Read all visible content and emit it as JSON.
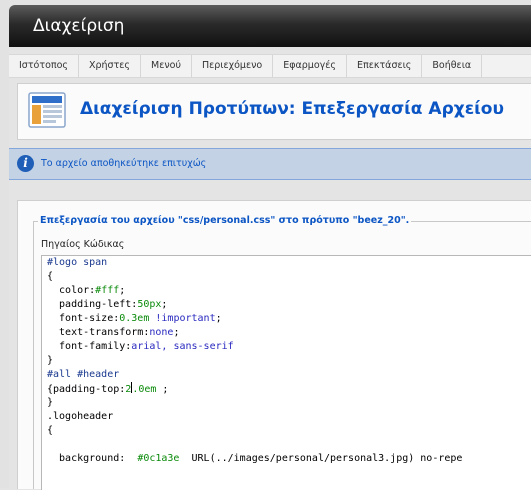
{
  "header": {
    "title": "Διαχείριση"
  },
  "menu": {
    "items": [
      "Ιστότοπος",
      "Χρήστες",
      "Μενού",
      "Περιεχόμενο",
      "Εφαρμογές",
      "Επεκτάσεις",
      "Βοήθεια"
    ]
  },
  "toolbar": {
    "icon": "template-manager-icon",
    "title": "Διαχείριση Προτύπων: Επεξεργασία Αρχείου"
  },
  "message": {
    "icon": "info-icon",
    "text": "Το αρχείο αποθηκεύτηκε επιτυχώς"
  },
  "editor": {
    "legend": "Επεξεργασία του αρχείου \"css/personal.css\" στο πρότυπο \"beez_20\".",
    "source_label": "Πηγαίος Κώδικας",
    "lines": {
      "l1": "#logo span",
      "l2": "{",
      "l3_prop": "  color:",
      "l3_val": "#fff",
      "l3_end": ";",
      "l4_prop": "  padding-left:",
      "l4_val": "50px",
      "l4_end": ";",
      "l5_prop": "  font-size:",
      "l5_val": "0.3em",
      "l5_kw": " !important",
      "l5_end": ";",
      "l6_prop": "  text-transform:",
      "l6_val": "none",
      "l6_end": ";",
      "l7_prop": "  font-family:",
      "l7_val": "arial, sans-serif",
      "l8": "}",
      "l9": "#all #header",
      "l10_prop": "{padding-top:",
      "l10_val_a": "2",
      "l10_val_b": ".0em",
      "l10_end": " ;",
      "l11": "}",
      "l12": ".logoheader",
      "l13": "{",
      "l14": "",
      "l15_prop": "  background:  ",
      "l15_val": "#0c1a3e",
      "l15_rest": "  URL(../images/personal/personal3.jpg) no-repe"
    }
  },
  "colors": {
    "title_blue": "#0b55c4",
    "message_bg": "#c3d2e5",
    "code_value_green": "#0a8a0a"
  }
}
